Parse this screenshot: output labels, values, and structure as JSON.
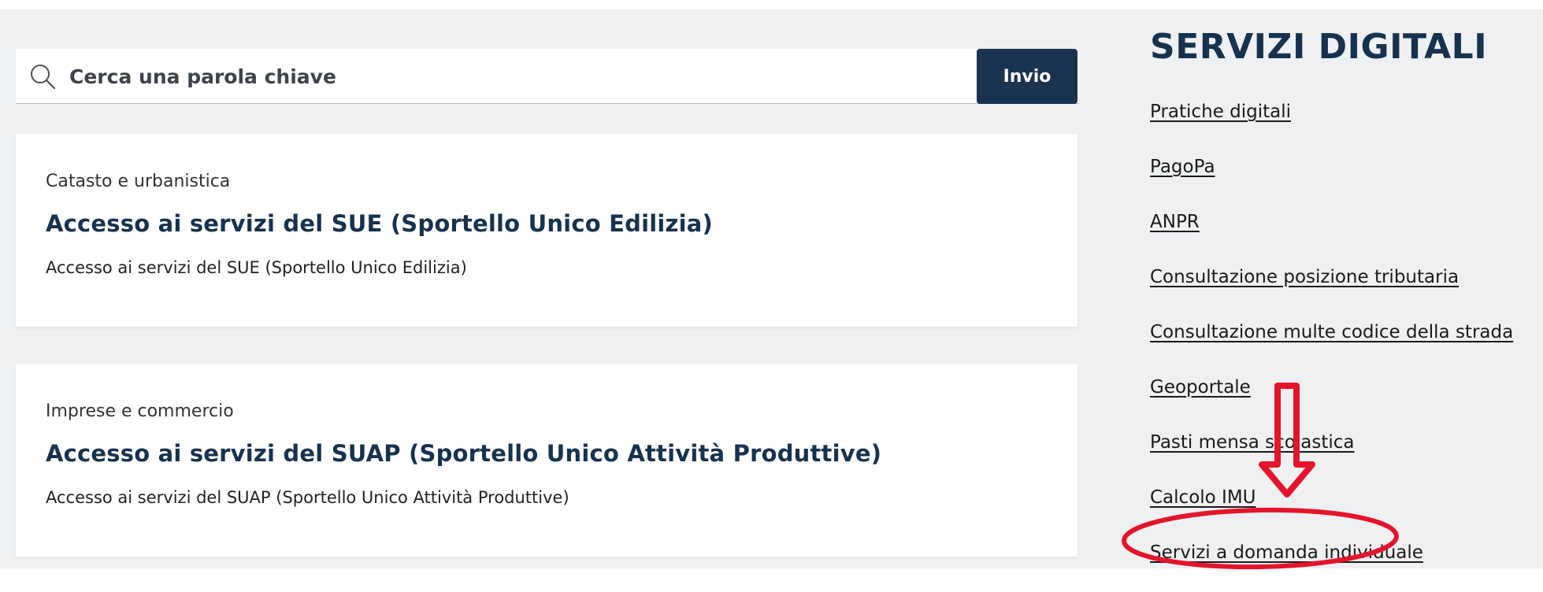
{
  "search": {
    "placeholder": "Cerca una parola chiave",
    "button_label": "Invio"
  },
  "cards": [
    {
      "category": "Catasto e urbanistica",
      "title": "Accesso ai servizi del SUE (Sportello Unico Edilizia)",
      "description": "Accesso ai servizi del SUE (Sportello Unico Edilizia)"
    },
    {
      "category": "Imprese e commercio",
      "title": "Accesso ai servizi del SUAP (Sportello Unico Attività Produttive)",
      "description": "Accesso ai servizi del SUAP (Sportello Unico Attività Produttive)"
    }
  ],
  "sidebar": {
    "title": "SERVIZI DIGITALI",
    "links": [
      "Pratiche digitali",
      "PagoPa",
      "ANPR",
      "Consultazione posizione tributaria",
      "Consultazione multe codice della strada",
      "Geoportale",
      "Pasti mensa scolastica",
      "Calcolo IMU",
      "Servizi a domanda individuale"
    ]
  },
  "colors": {
    "panel_bg": "#eef0f2",
    "primary": "#1b3350",
    "title_text": "#17324d",
    "annotation": "#e3142b"
  },
  "icons": {
    "search": "search-icon",
    "annotation_arrow": "down-arrow-icon",
    "annotation_ellipse": "highlight-ellipse"
  }
}
